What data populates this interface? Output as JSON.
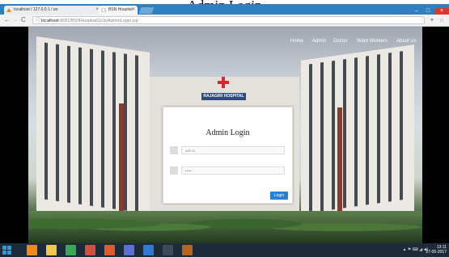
{
  "caption": "Admin Login",
  "browser": {
    "tabs": [
      {
        "label": "localhost / 127.0.0.1 / an",
        "close": "×"
      },
      {
        "label": "BSN Hospital",
        "close": "×"
      }
    ],
    "window_buttons": {
      "minimize": "–",
      "maximize": "□",
      "close": "×"
    },
    "nav": {
      "back": "←",
      "forward": "→",
      "reload": "C"
    },
    "address": {
      "host": "localhost",
      "path": ":8081/BSNHospitalGUIs/AdminLogin.jsp",
      "info": "ⓘ"
    },
    "tools": {
      "extensions": "⚭",
      "star": "☆"
    }
  },
  "site": {
    "menu": [
      "Home",
      "Admin",
      "Doctor",
      "Ward Workers",
      "About Us"
    ],
    "hospital_sign": "RAJAGIRI HOSPITAL"
  },
  "login": {
    "title": "Admin Login",
    "username_placeholder": "admin",
    "password_placeholder": "•••••",
    "button": "Login"
  },
  "taskbar": {
    "apps": [
      {
        "icon": "vlc-icon",
        "color": "#f08a1c"
      },
      {
        "icon": "file-explorer-icon",
        "color": "#f2c84b"
      },
      {
        "icon": "chrome-icon",
        "color": "#3aa757"
      },
      {
        "icon": "app-icon",
        "color": "#d44e3b"
      },
      {
        "icon": "app-icon-2",
        "color": "#e05a2b"
      },
      {
        "icon": "app-icon-3",
        "color": "#5b6fd6"
      },
      {
        "icon": "outlook-icon",
        "color": "#2f7ad4"
      },
      {
        "icon": "terminal-icon",
        "color": "#3c4b5c"
      },
      {
        "icon": "settings-icon",
        "color": "#b5651d"
      }
    ],
    "tray": "▲ ⚑ ⌨ ◢ ◀)",
    "time": "13:11",
    "date": "27-05-2017"
  }
}
